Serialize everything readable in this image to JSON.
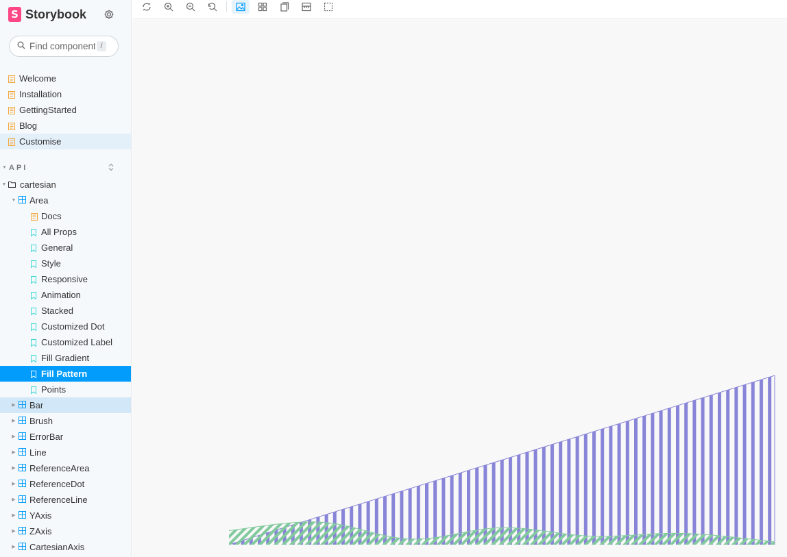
{
  "app": {
    "brand": "Storybook",
    "logo_letter": "S"
  },
  "search": {
    "placeholder": "Find components",
    "shortcut": "/"
  },
  "docs_nav": [
    "Welcome",
    "Installation",
    "GettingStarted",
    "Blog",
    "Customise"
  ],
  "section": {
    "label": "API"
  },
  "folder": {
    "label": "cartesian"
  },
  "area_component": {
    "label": "Area"
  },
  "area_stories": [
    "Docs",
    "All Props",
    "General",
    "Style",
    "Responsive",
    "Animation",
    "Stacked",
    "Customized Dot",
    "Customized Label",
    "Fill Gradient",
    "Fill Pattern",
    "Points"
  ],
  "selected_story": "Fill Pattern",
  "components": [
    "Bar",
    "Brush",
    "ErrorBar",
    "Line",
    "ReferenceArea",
    "ReferenceDot",
    "ReferenceLine",
    "YAxis",
    "ZAxis",
    "CartesianAxis"
  ],
  "toolbar": {
    "tools": [
      "sync-icon",
      "zoom-in-icon",
      "zoom-out-icon",
      "reset-zoom-icon",
      "background-icon",
      "grid-icon",
      "viewport-icon",
      "measure-icon",
      "outline-icon"
    ],
    "active_tool": "background-icon"
  },
  "colors": {
    "accent": "#029cfd",
    "brand": "#ff4785",
    "doc_icon": "#f4a83c",
    "story_icon": "#37d5d3",
    "component_icon": "#029cfd",
    "series_purple": "#8884d8",
    "series_green": "#82ca9d"
  },
  "chart_data": {
    "type": "area",
    "x": [
      0,
      1,
      2,
      3,
      4,
      5,
      6
    ],
    "series": [
      {
        "values": [
          0,
          10,
          20,
          30,
          40,
          50,
          60
        ],
        "color": "#8884d8",
        "fill": "vertical-stripe-pattern"
      },
      {
        "values": [
          5,
          8,
          2,
          6,
          3,
          4,
          1
        ],
        "color": "#82ca9d",
        "fill": "diagonal-stripe-pattern"
      }
    ],
    "axes_visible": false,
    "grid": false,
    "legend": "none"
  }
}
